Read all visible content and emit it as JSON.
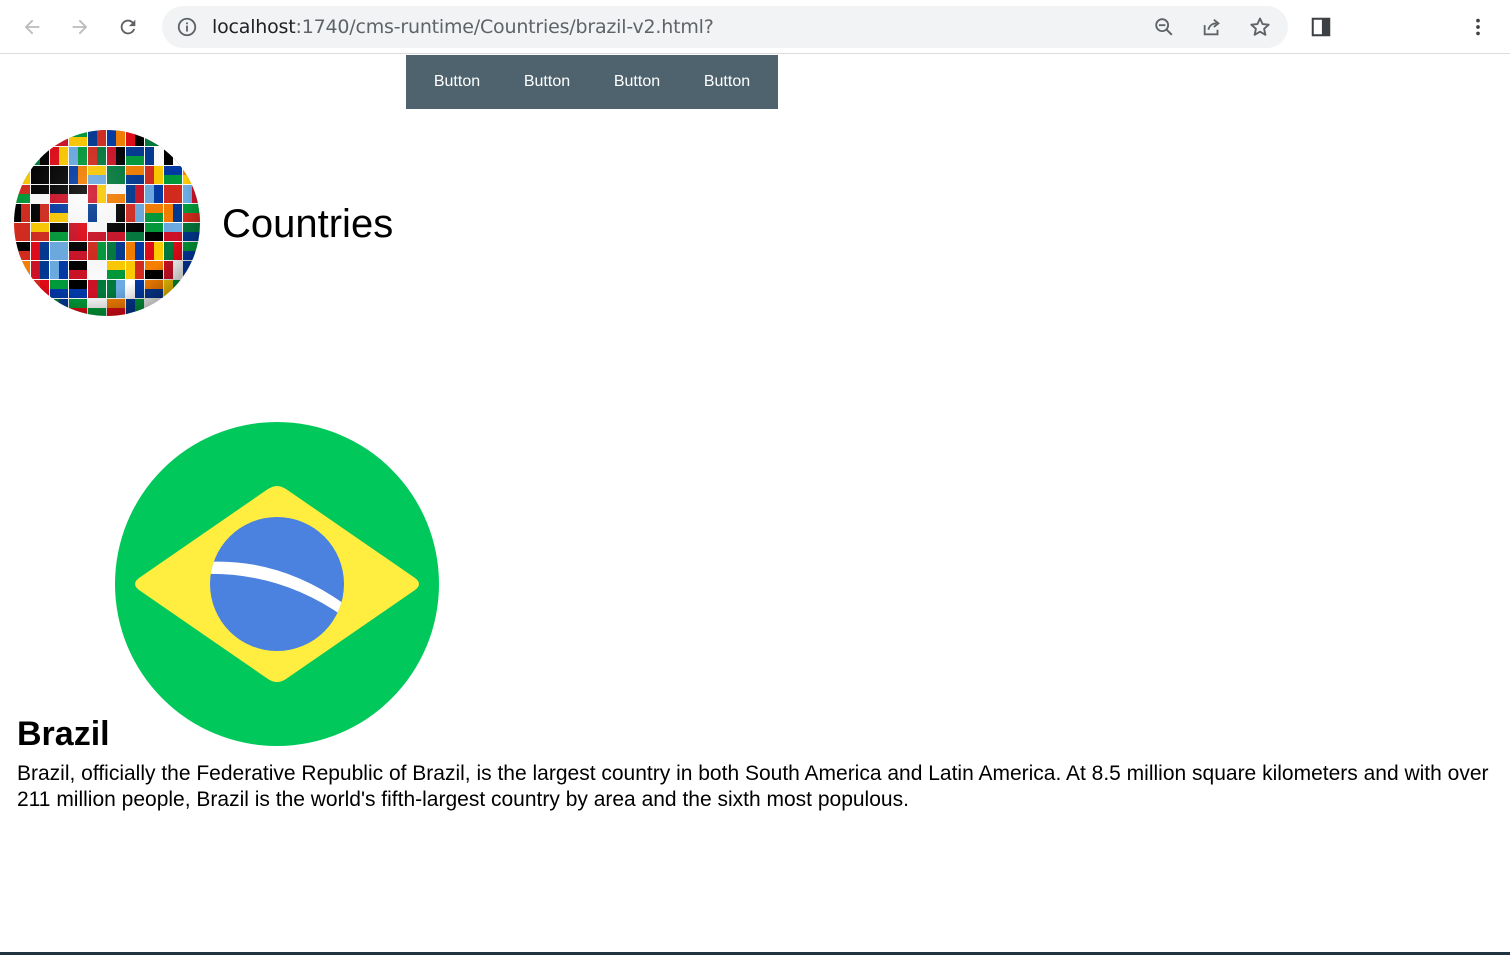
{
  "browser": {
    "url_host": "localhost",
    "url_path": ":1740/cms-runtime/Countries/brazil-v2.html?",
    "back_icon": "back-arrow-icon",
    "forward_icon": "forward-arrow-icon",
    "reload_icon": "reload-icon",
    "site_info_icon": "info-icon",
    "zoom_icon": "zoom-out-icon",
    "share_icon": "share-icon",
    "bookmark_icon": "star-icon",
    "side_panel_icon": "side-panel-icon",
    "menu_icon": "kebab-menu-icon"
  },
  "nav": {
    "buttons": [
      "Button",
      "Button",
      "Button",
      "Button"
    ],
    "background": "#4f636e"
  },
  "header": {
    "title": "Countries",
    "logo": "world-flags-globe"
  },
  "country": {
    "name": "Brazil",
    "description": "Brazil, officially the Federative Republic of Brazil, is the largest country in both South America and Latin America. At 8.5 million square kilometers and with over 211 million people, Brazil is the world's fifth-largest country by area and the sixth most populous.",
    "flag": "brazil-flag",
    "flag_colors": {
      "green": "#00c85a",
      "yellow": "#ffee3f",
      "blue": "#4b81df",
      "white": "#ffffff"
    }
  }
}
